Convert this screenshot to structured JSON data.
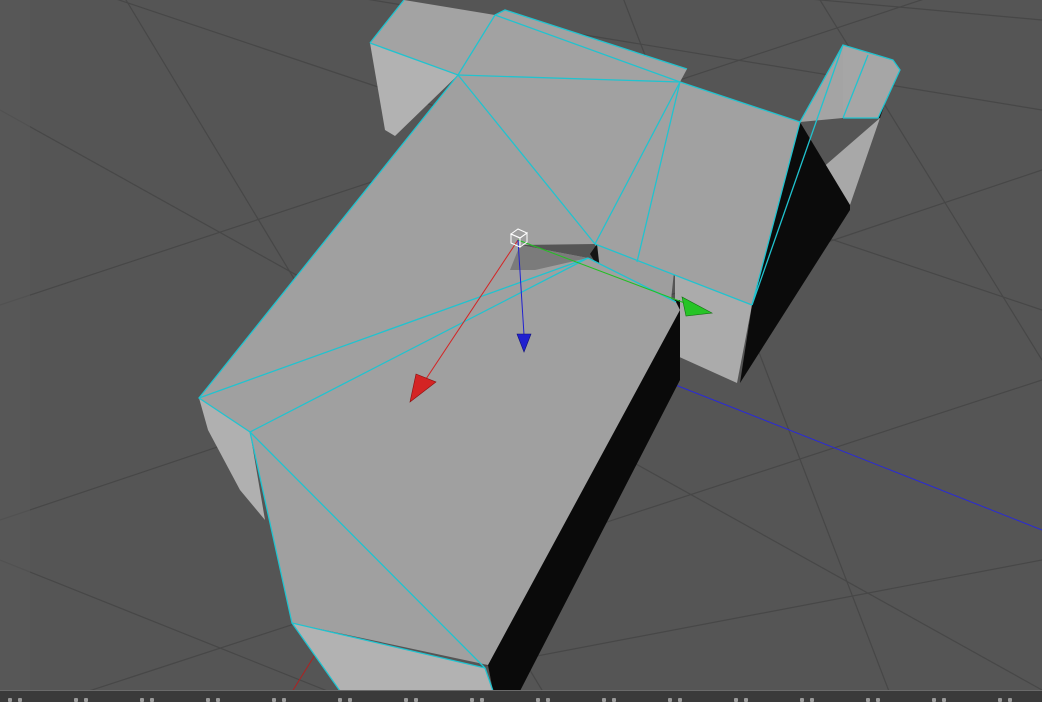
{
  "viewport": {
    "background": "#555555",
    "grid_line_color": "#474747",
    "mesh_face_color": "#a0a0a0",
    "mesh_side_light": "#b4b4b4",
    "mesh_side_dark": "#0c0c0c",
    "wireframe_highlight_color": "#21c3cf",
    "world_axis_color": "#2a2ad6"
  },
  "gizmo": {
    "x_axis_color": "#d42424",
    "y_axis_color": "#22c022",
    "z_axis_color": "#2020d0",
    "center_handle_color": "#ffffff",
    "x_handle_icon": "cone-arrow",
    "y_handle_icon": "cone-arrow",
    "z_handle_icon": "cone-arrow",
    "center_icon": "cube-outline"
  },
  "timeline": {
    "background": "#3a3a3a",
    "tick_color": "#9a9a9a"
  }
}
